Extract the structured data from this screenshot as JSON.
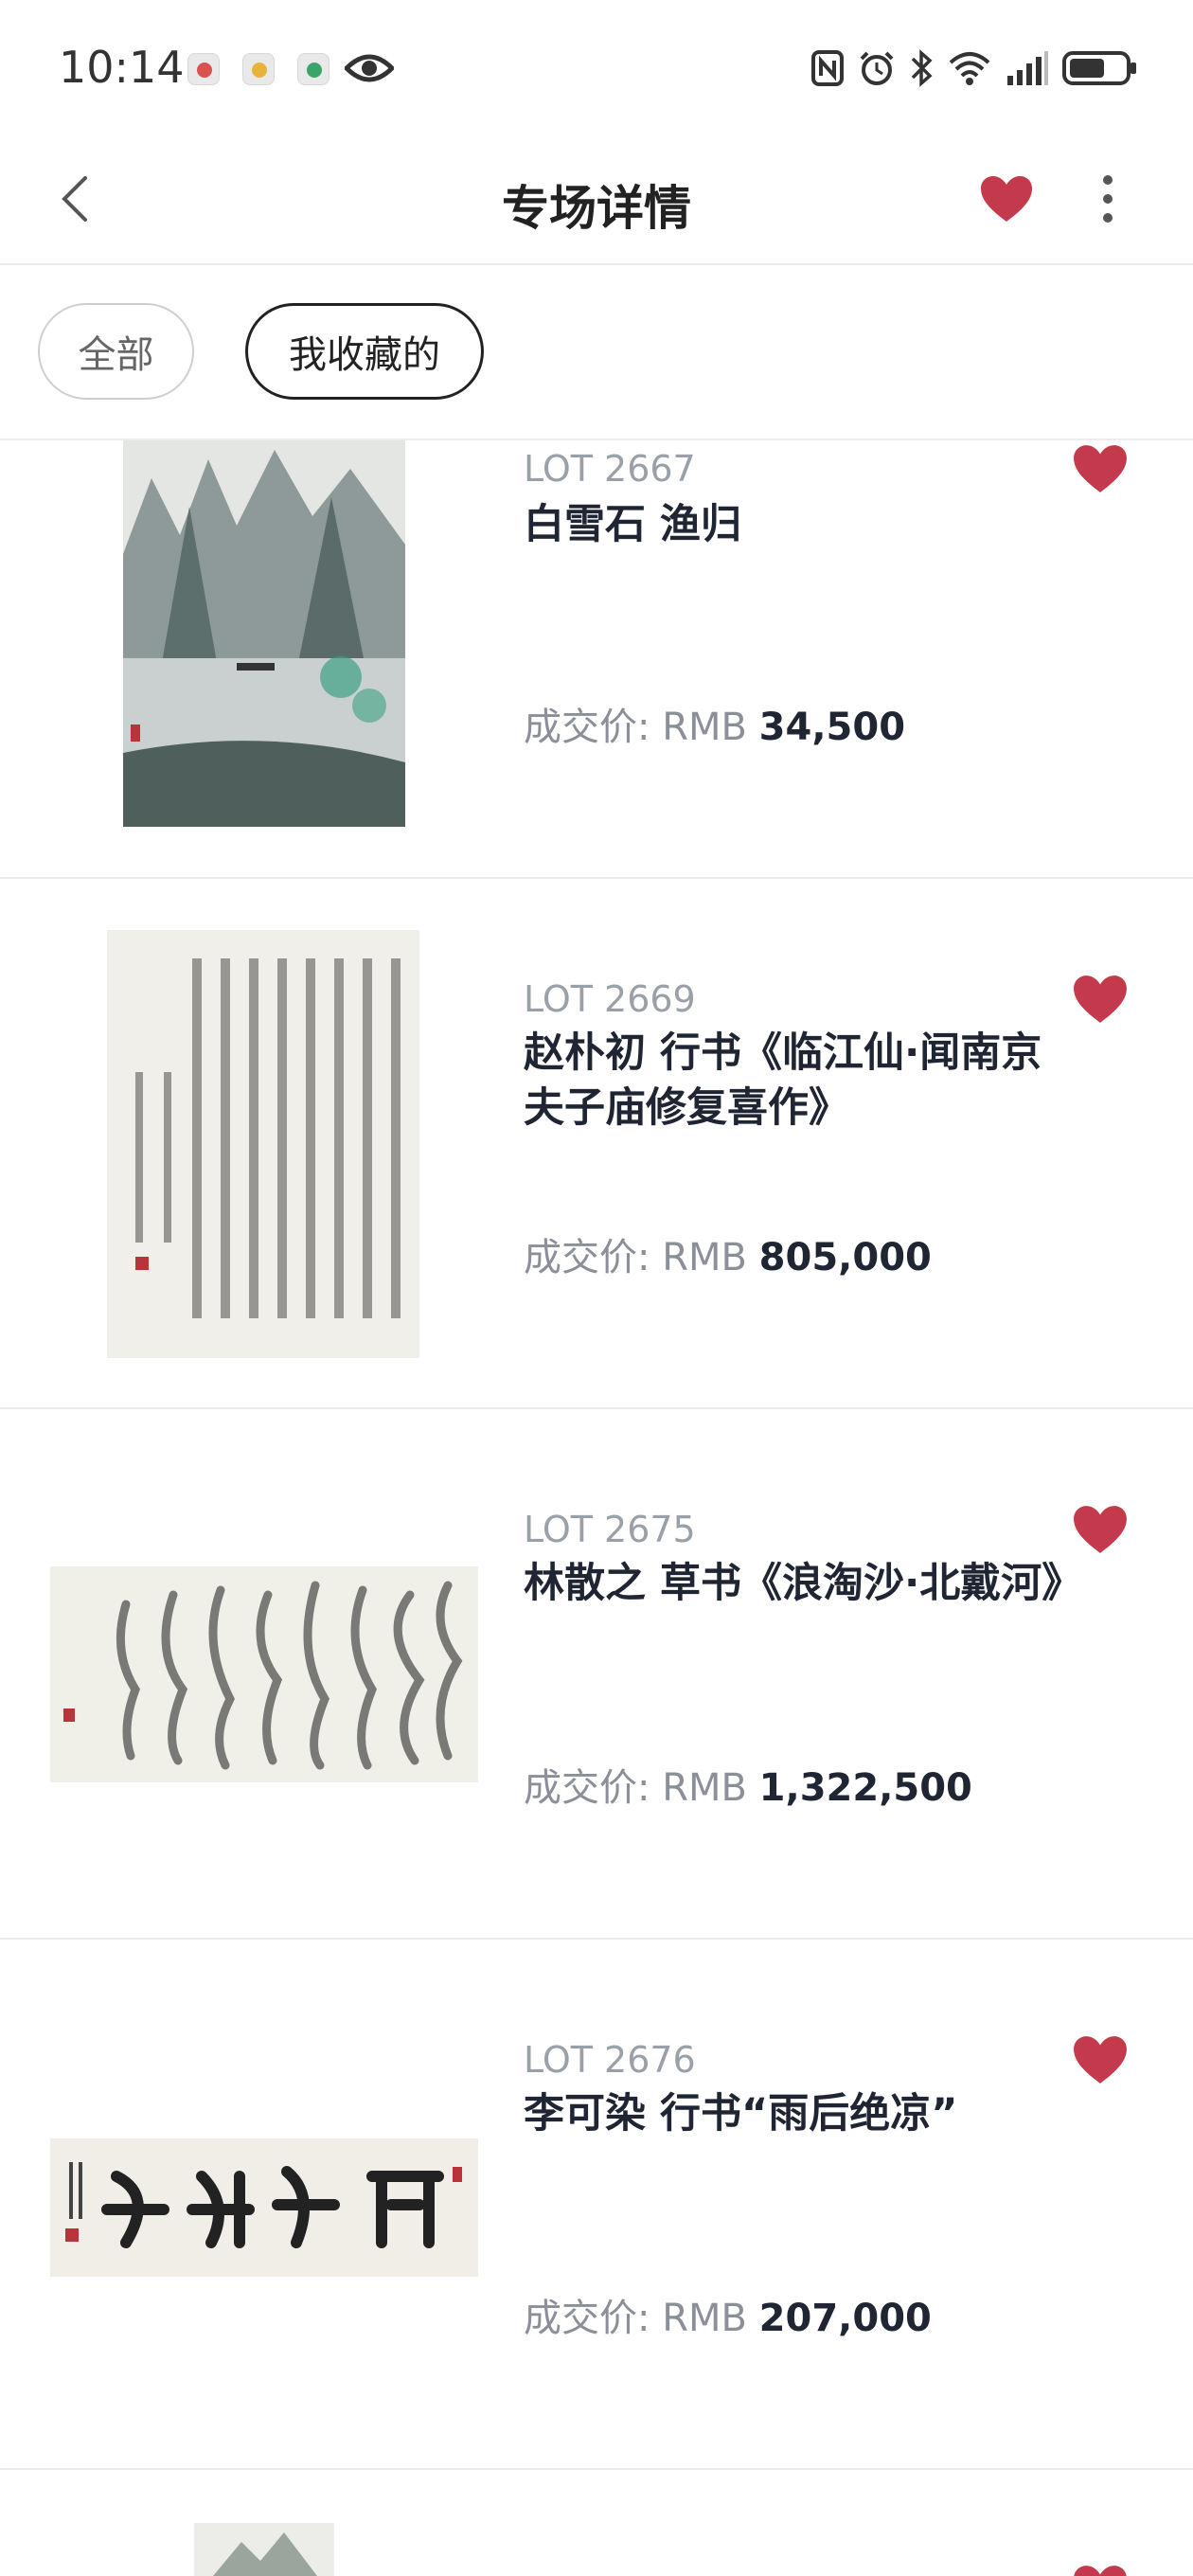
{
  "status_bar": {
    "time": "10:14"
  },
  "header": {
    "title": "专场详情",
    "favorite_color": "#c23a4b"
  },
  "filters": {
    "all": "全部",
    "favorites": "我收藏的",
    "selected": "我收藏的"
  },
  "price_label": "成交价:",
  "currency": "RMB",
  "lots": [
    {
      "lot": "LOT 2667",
      "title": "白雪石  渔归",
      "price": "34,500"
    },
    {
      "lot": "LOT 2669",
      "title": "赵朴初  行书《临江仙·闻南京夫子庙修复喜作》",
      "price": "805,000"
    },
    {
      "lot": "LOT 2675",
      "title": "林散之  草书《浪淘沙·北戴河》",
      "price": "1,322,500"
    },
    {
      "lot": "LOT 2676",
      "title": "李可染  行书“雨后绝凉”",
      "price": "207,000"
    }
  ]
}
